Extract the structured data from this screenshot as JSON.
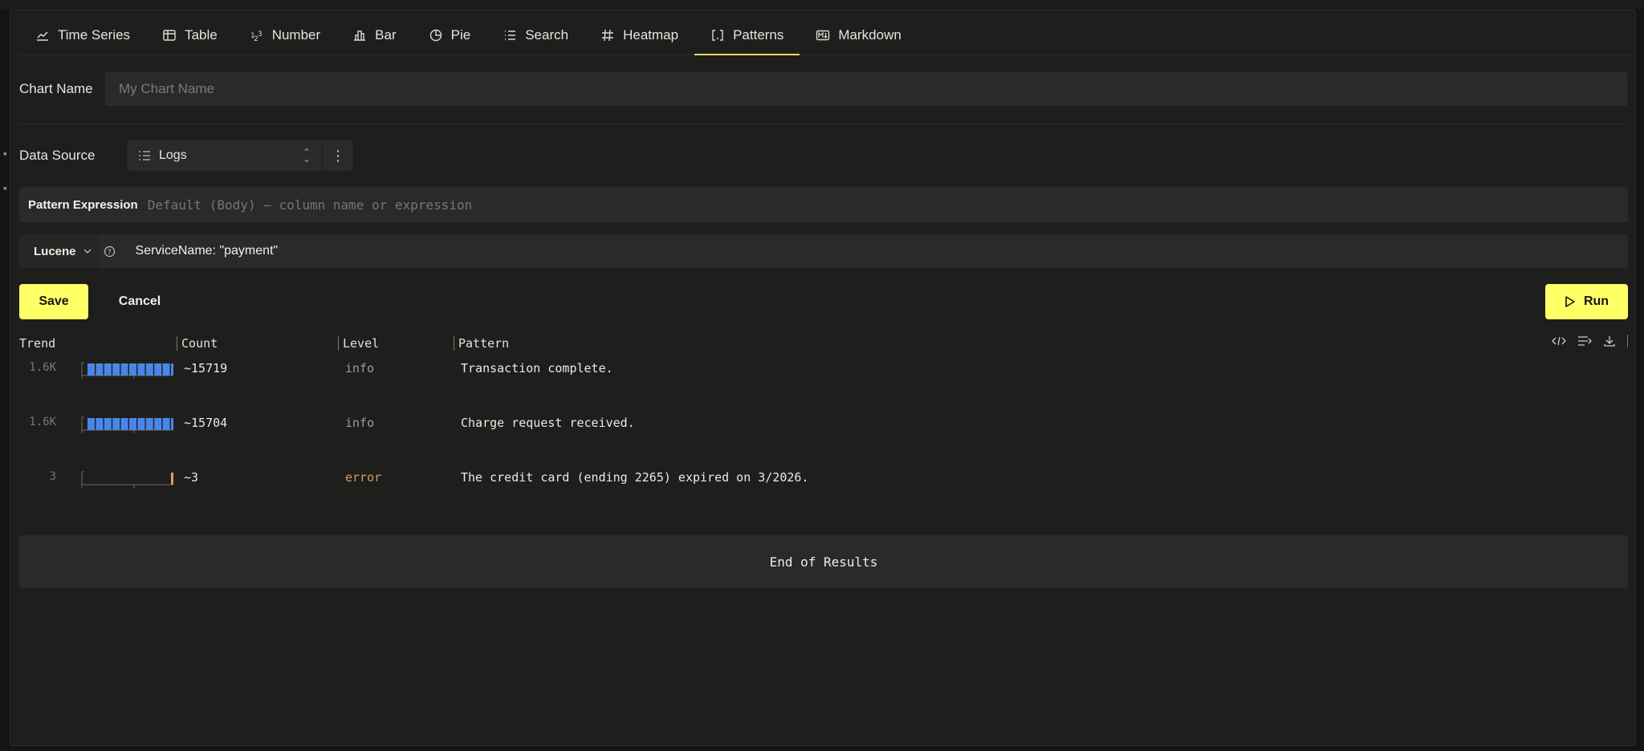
{
  "tabs": [
    {
      "label": "Time Series",
      "icon": "line-chart-icon"
    },
    {
      "label": "Table",
      "icon": "table-icon"
    },
    {
      "label": "Number",
      "icon": "number-icon"
    },
    {
      "label": "Bar",
      "icon": "bar-chart-icon"
    },
    {
      "label": "Pie",
      "icon": "pie-chart-icon"
    },
    {
      "label": "Search",
      "icon": "list-icon"
    },
    {
      "label": "Heatmap",
      "icon": "hash-icon"
    },
    {
      "label": "Patterns",
      "icon": "brackets-icon",
      "active": true
    },
    {
      "label": "Markdown",
      "icon": "markdown-icon"
    }
  ],
  "form": {
    "chart_name_label": "Chart Name",
    "chart_name_placeholder": "My Chart Name",
    "data_source_label": "Data Source",
    "data_source_value": "Logs",
    "pattern_label": "Pattern Expression",
    "pattern_placeholder": "Default (Body) — column name or expression",
    "query_language": "Lucene",
    "query_text": "ServiceName: \"payment\""
  },
  "actions": {
    "save": "Save",
    "cancel": "Cancel",
    "run": "Run"
  },
  "table": {
    "headers": [
      "Trend",
      "Count",
      "Level",
      "Pattern"
    ],
    "rows": [
      {
        "max": "1.6K",
        "count": "~15719",
        "level": "info",
        "pattern": "Transaction complete.",
        "trend": [
          1,
          1,
          1,
          1,
          1,
          1,
          1,
          1,
          1,
          1,
          1,
          0.55
        ],
        "trend_color": "#4a86e8"
      },
      {
        "max": "1.6K",
        "count": "~15704",
        "level": "info",
        "pattern": "Charge request received.",
        "trend": [
          1,
          1,
          1,
          1,
          1,
          1,
          1,
          1,
          1,
          1,
          1,
          0.55
        ],
        "trend_color": "#4a86e8"
      },
      {
        "max": "3",
        "count": "~3",
        "level": "error",
        "pattern": "The credit card (ending 2265) expired on 3/2026.",
        "trend": [
          0,
          0,
          0,
          0,
          0,
          0,
          0,
          0,
          0,
          0,
          1,
          0
        ],
        "trend_color": "#d6a06a"
      }
    ],
    "end_text": "End of Results"
  },
  "colors": {
    "accent": "#ffff66",
    "tab_underline": "#e9d85e",
    "error": "#d79b5c"
  }
}
